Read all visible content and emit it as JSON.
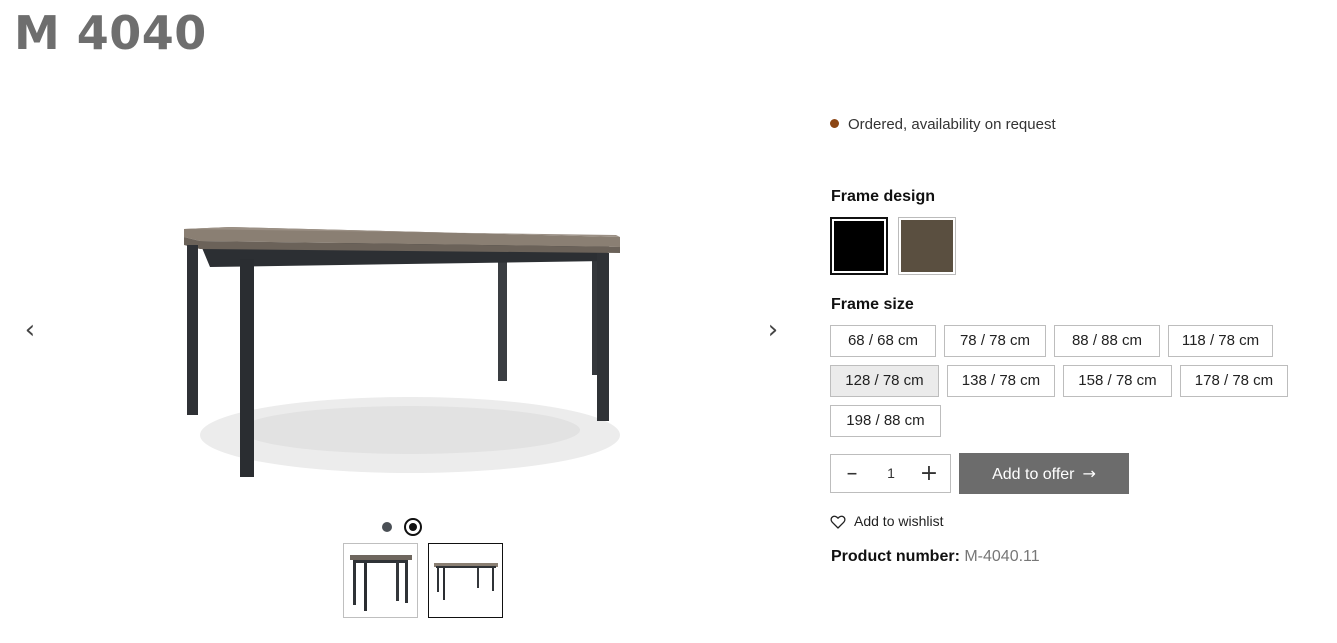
{
  "product": {
    "title": "M 4040"
  },
  "gallery": {
    "prev_icon": "chevron-left-icon",
    "next_icon": "chevron-right-icon",
    "slides": 2,
    "active_slide": 2
  },
  "availability": {
    "text": "Ordered, availability on request",
    "dot_color": "#8b4513"
  },
  "frame_design": {
    "label": "Frame design",
    "options": [
      {
        "color": "#000000",
        "selected": true
      },
      {
        "color": "#5a4f40",
        "selected": false
      }
    ]
  },
  "frame_size": {
    "label": "Frame size",
    "options": [
      "68 / 68 cm",
      "78 / 78 cm",
      "88 / 88 cm",
      "118 / 78 cm",
      "128 / 78 cm",
      "138 / 78 cm",
      "158 / 78 cm",
      "178 / 78 cm",
      "198 / 88 cm"
    ],
    "selected": "128 / 78 cm"
  },
  "quantity": {
    "value": "1",
    "minus_icon": "minus-icon",
    "plus_icon": "plus-icon"
  },
  "add_to_offer": {
    "label": "Add to offer",
    "icon": "arrow-right-icon",
    "color": "#6c6c6c"
  },
  "wishlist": {
    "label": "Add to wishlist",
    "icon": "heart-icon"
  },
  "product_number": {
    "label": "Product number:",
    "value": "M-4040.11"
  }
}
